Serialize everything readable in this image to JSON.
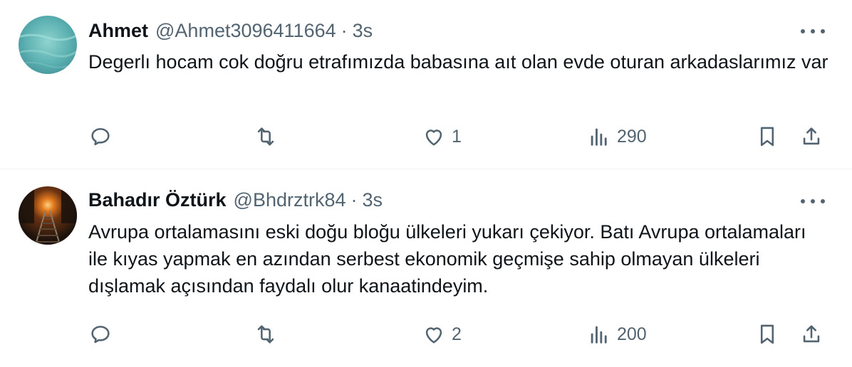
{
  "tweets": [
    {
      "name": "Ahmet",
      "handle": "@Ahmet3096411664",
      "separator": "·",
      "time": "3s",
      "text": "Degerlı hocam cok doğru etrafımızda babasına aıt olan evde oturan arkadaslarımız var",
      "likes": "1",
      "views": "290",
      "avatar_color": "#5fb3b3"
    },
    {
      "name": "Bahadır Öztürk",
      "handle": "@Bhdrztrk84",
      "separator": "·",
      "time": "3s",
      "text": "Avrupa ortalamasını eski doğu bloğu ülkeleri yukarı çekiyor. Batı Avrupa ortalamaları ile kıyas yapmak en azından serbest ekonomik geçmişe sahip olmayan ülkeleri dışlamak açısından faydalı olur kanaatindeyim.",
      "likes": "2",
      "views": "200",
      "avatar_color": "#2b1a10"
    }
  ],
  "colors": {
    "secondary_text": "#536471",
    "primary_text": "#0f1419",
    "divider": "#eff3f4"
  },
  "icons": [
    "reply-icon",
    "retweet-icon",
    "like-icon",
    "views-icon",
    "bookmark-icon",
    "share-icon",
    "more-icon"
  ]
}
